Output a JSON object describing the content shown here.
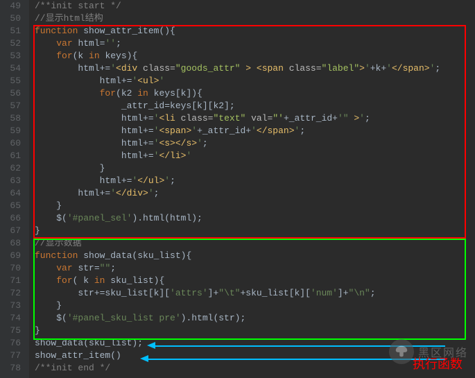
{
  "gutter": {
    "start": 49,
    "end": 78
  },
  "watermark": "黑区网络",
  "annotation": "执行函数",
  "lines": [
    {
      "n": 49,
      "t": [
        {
          "c": "c-comment",
          "v": "/**init start */"
        }
      ]
    },
    {
      "n": 50,
      "t": [
        {
          "c": "c-comment",
          "v": "//显示html结构"
        }
      ]
    },
    {
      "n": 51,
      "t": [
        {
          "c": "c-keyword",
          "v": "function "
        },
        {
          "c": "c-default",
          "v": "show_attr_item(){"
        }
      ]
    },
    {
      "n": 52,
      "t": [
        {
          "c": "c-default",
          "v": "    "
        },
        {
          "c": "c-keyword",
          "v": "var "
        },
        {
          "c": "c-default",
          "v": "html="
        },
        {
          "c": "c-string",
          "v": "''"
        },
        {
          "c": "c-default",
          "v": ";"
        }
      ]
    },
    {
      "n": 53,
      "t": [
        {
          "c": "c-default",
          "v": "    "
        },
        {
          "c": "c-keyword",
          "v": "for"
        },
        {
          "c": "c-default",
          "v": "(k "
        },
        {
          "c": "c-keyword",
          "v": "in"
        },
        {
          "c": "c-default",
          "v": " keys){"
        }
      ]
    },
    {
      "n": 54,
      "t": [
        {
          "c": "c-default",
          "v": "        html+="
        },
        {
          "c": "c-string",
          "v": "'"
        },
        {
          "c": "c-tag",
          "v": "<div "
        },
        {
          "c": "c-attrname",
          "v": "class="
        },
        {
          "c": "c-attrval",
          "v": "\"goods_attr\""
        },
        {
          "c": "c-tag",
          "v": " > <span "
        },
        {
          "c": "c-attrname",
          "v": "class="
        },
        {
          "c": "c-attrval",
          "v": "\"label\""
        },
        {
          "c": "c-tag",
          "v": ">"
        },
        {
          "c": "c-string",
          "v": "'"
        },
        {
          "c": "c-default",
          "v": "+k+"
        },
        {
          "c": "c-string",
          "v": "'"
        },
        {
          "c": "c-tag",
          "v": "</span>"
        },
        {
          "c": "c-string",
          "v": "'"
        },
        {
          "c": "c-default",
          "v": ";"
        }
      ]
    },
    {
      "n": 55,
      "t": [
        {
          "c": "c-default",
          "v": "            html+="
        },
        {
          "c": "c-string",
          "v": "'"
        },
        {
          "c": "c-tag",
          "v": "<ul>"
        },
        {
          "c": "c-string",
          "v": "'"
        }
      ]
    },
    {
      "n": 56,
      "t": [
        {
          "c": "c-default",
          "v": "            "
        },
        {
          "c": "c-keyword",
          "v": "for"
        },
        {
          "c": "c-default",
          "v": "(k2 "
        },
        {
          "c": "c-keyword",
          "v": "in"
        },
        {
          "c": "c-default",
          "v": " keys[k]){"
        }
      ]
    },
    {
      "n": 57,
      "t": [
        {
          "c": "c-default",
          "v": "                _attr_id=keys[k][k2];"
        }
      ]
    },
    {
      "n": 58,
      "t": [
        {
          "c": "c-default",
          "v": "                html+="
        },
        {
          "c": "c-string",
          "v": "'"
        },
        {
          "c": "c-tag",
          "v": "<li "
        },
        {
          "c": "c-attrname",
          "v": "class="
        },
        {
          "c": "c-attrval",
          "v": "\"text\""
        },
        {
          "c": "c-tag",
          "v": " "
        },
        {
          "c": "c-attrname",
          "v": "val="
        },
        {
          "c": "c-attrval",
          "v": "\"'"
        },
        {
          "c": "c-default",
          "v": "+_attr_id+"
        },
        {
          "c": "c-string",
          "v": "'\""
        },
        {
          "c": "c-tag",
          "v": " >"
        },
        {
          "c": "c-string",
          "v": "'"
        },
        {
          "c": "c-default",
          "v": ";"
        }
      ]
    },
    {
      "n": 59,
      "t": [
        {
          "c": "c-default",
          "v": "                html+="
        },
        {
          "c": "c-string",
          "v": "'"
        },
        {
          "c": "c-tag",
          "v": "<span>"
        },
        {
          "c": "c-string",
          "v": "'"
        },
        {
          "c": "c-default",
          "v": "+_attr_id+"
        },
        {
          "c": "c-string",
          "v": "'"
        },
        {
          "c": "c-tag",
          "v": "</span>"
        },
        {
          "c": "c-string",
          "v": "'"
        },
        {
          "c": "c-default",
          "v": ";"
        }
      ]
    },
    {
      "n": 60,
      "t": [
        {
          "c": "c-default",
          "v": "                html+="
        },
        {
          "c": "c-string",
          "v": "'"
        },
        {
          "c": "c-tag",
          "v": "<s></s>"
        },
        {
          "c": "c-string",
          "v": "'"
        },
        {
          "c": "c-default",
          "v": ";"
        }
      ]
    },
    {
      "n": 61,
      "t": [
        {
          "c": "c-default",
          "v": "                html+="
        },
        {
          "c": "c-string",
          "v": "'"
        },
        {
          "c": "c-tag",
          "v": "</li>"
        },
        {
          "c": "c-string",
          "v": "'"
        }
      ]
    },
    {
      "n": 62,
      "t": [
        {
          "c": "c-default",
          "v": "            }"
        }
      ]
    },
    {
      "n": 63,
      "t": [
        {
          "c": "c-default",
          "v": "            html+="
        },
        {
          "c": "c-string",
          "v": "'"
        },
        {
          "c": "c-tag",
          "v": "</ul>"
        },
        {
          "c": "c-string",
          "v": "'"
        },
        {
          "c": "c-default",
          "v": ";"
        }
      ]
    },
    {
      "n": 64,
      "t": [
        {
          "c": "c-default",
          "v": "        html+="
        },
        {
          "c": "c-string",
          "v": "'"
        },
        {
          "c": "c-tag",
          "v": "</div>"
        },
        {
          "c": "c-string",
          "v": "'"
        },
        {
          "c": "c-default",
          "v": ";"
        }
      ]
    },
    {
      "n": 65,
      "t": [
        {
          "c": "c-default",
          "v": "    }"
        }
      ]
    },
    {
      "n": 66,
      "t": [
        {
          "c": "c-default",
          "v": "    $("
        },
        {
          "c": "c-string",
          "v": "'#panel_sel'"
        },
        {
          "c": "c-default",
          "v": ").html(html);"
        }
      ]
    },
    {
      "n": 67,
      "t": [
        {
          "c": "c-default",
          "v": "}"
        }
      ]
    },
    {
      "n": 68,
      "t": [
        {
          "c": "c-comment",
          "v": "//显示数据"
        }
      ]
    },
    {
      "n": 69,
      "t": [
        {
          "c": "c-keyword",
          "v": "function "
        },
        {
          "c": "c-default",
          "v": "show_data(sku_list){"
        }
      ]
    },
    {
      "n": 70,
      "t": [
        {
          "c": "c-default",
          "v": "    "
        },
        {
          "c": "c-keyword",
          "v": "var "
        },
        {
          "c": "c-default",
          "v": "str="
        },
        {
          "c": "c-string",
          "v": "\"\""
        },
        {
          "c": "c-default",
          "v": ";"
        }
      ]
    },
    {
      "n": 71,
      "t": [
        {
          "c": "c-default",
          "v": "    "
        },
        {
          "c": "c-keyword",
          "v": "for"
        },
        {
          "c": "c-default",
          "v": "( k "
        },
        {
          "c": "c-keyword",
          "v": "in"
        },
        {
          "c": "c-default",
          "v": " sku_list){"
        }
      ]
    },
    {
      "n": 72,
      "t": [
        {
          "c": "c-default",
          "v": "        str+=sku_list[k]["
        },
        {
          "c": "c-string",
          "v": "'attrs'"
        },
        {
          "c": "c-default",
          "v": "]+"
        },
        {
          "c": "c-string",
          "v": "\"\\t\""
        },
        {
          "c": "c-default",
          "v": "+sku_list[k]["
        },
        {
          "c": "c-string",
          "v": "'num'"
        },
        {
          "c": "c-default",
          "v": "]+"
        },
        {
          "c": "c-string",
          "v": "\"\\n\""
        },
        {
          "c": "c-default",
          "v": ";"
        }
      ]
    },
    {
      "n": 73,
      "t": [
        {
          "c": "c-default",
          "v": "    }"
        }
      ]
    },
    {
      "n": 74,
      "t": [
        {
          "c": "c-default",
          "v": "    $("
        },
        {
          "c": "c-string",
          "v": "'#panel_sku_list pre'"
        },
        {
          "c": "c-default",
          "v": ").html(str);"
        }
      ]
    },
    {
      "n": 75,
      "t": [
        {
          "c": "c-default",
          "v": "}"
        }
      ]
    },
    {
      "n": 76,
      "t": [
        {
          "c": "c-default",
          "v": "show_data(sku_list);"
        }
      ]
    },
    {
      "n": 77,
      "t": [
        {
          "c": "c-default",
          "v": "show_attr_item()"
        }
      ]
    },
    {
      "n": 78,
      "t": [
        {
          "c": "c-comment",
          "v": "/**init end */"
        }
      ]
    }
  ]
}
